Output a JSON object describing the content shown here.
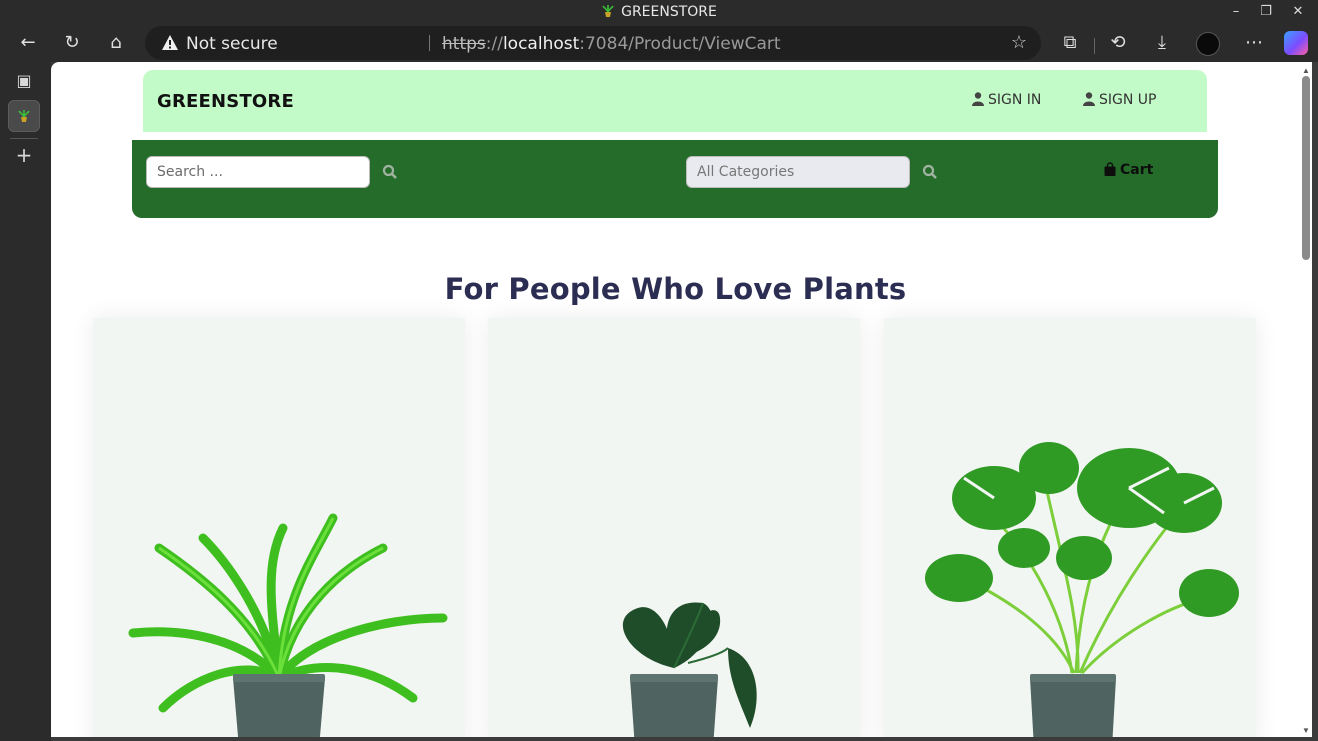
{
  "window": {
    "title": "GREENSTORE"
  },
  "browser": {
    "security_label": "Not secure",
    "url_scheme": "https",
    "url_sep": "://",
    "url_host": "localhost",
    "url_path": ":7084/Product/ViewCart"
  },
  "site": {
    "brand": "GREENSTORE",
    "sign_in": "SIGN IN",
    "sign_up": "SIGN UP",
    "search_placeholder": "Search ...",
    "category_placeholder": "All Categories",
    "cart_label": "Cart",
    "hero_title": "For People Who Love Plants"
  },
  "colors": {
    "topbar": "#c3fbc8",
    "navbar": "#256c2a",
    "title": "#2c2d52",
    "card_bg": "#f2f6f2"
  },
  "products": [
    {
      "icon": "birds-nest-fern-plant"
    },
    {
      "icon": "philodendron-plant"
    },
    {
      "icon": "monstera-plant"
    }
  ]
}
